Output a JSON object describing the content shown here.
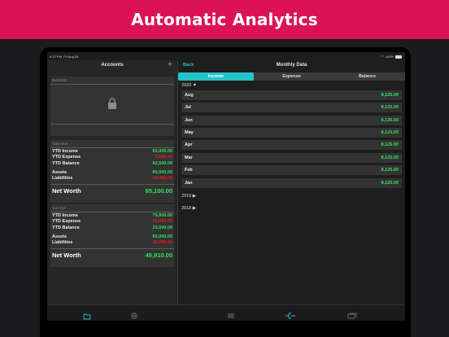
{
  "banner": {
    "title": "Automatic Analytics"
  },
  "status": {
    "time": "5:17 PM",
    "date": "Fri Aug 28",
    "battery": "100%"
  },
  "left": {
    "title": "Accounts",
    "add_label": "+",
    "locked_card": {
      "name": "Business"
    },
    "cards": [
      {
        "name": "Jane Doe",
        "rows": [
          {
            "label": "YTD Income",
            "value": "65,000.00",
            "color": "#2ee35a"
          },
          {
            "label": "YTD Expense",
            "value": "2,500.00",
            "color": "#e61a24"
          },
          {
            "label": "YTD Balance",
            "value": "62,500.00",
            "color": "#2ee35a"
          },
          {
            "label": "Assets",
            "value": "80,000.00",
            "color": "#2ee35a"
          },
          {
            "label": "Liabilities",
            "value": "14,900.00",
            "color": "#e61a24"
          }
        ],
        "net_worth_label": "Net Worth",
        "net_worth_value": "65,100.00"
      },
      {
        "name": "Jon Doe",
        "rows": [
          {
            "label": "YTD Income",
            "value": "75,000.00",
            "color": "#2ee35a"
          },
          {
            "label": "YTD Expense",
            "value": "52,000.00",
            "color": "#e61a24"
          },
          {
            "label": "YTD Balance",
            "value": "23,000.00",
            "color": "#2ee35a"
          },
          {
            "label": "Assets",
            "value": "60,000.00",
            "color": "#2ee35a"
          },
          {
            "label": "Liabilities",
            "value": "10,090.00",
            "color": "#e61a24"
          }
        ],
        "net_worth_label": "Net Worth",
        "net_worth_value": "49,910.00"
      }
    ]
  },
  "right": {
    "back_label": "Back",
    "title": "Monthly Data",
    "segments": [
      "Income",
      "Expense",
      "Balance"
    ],
    "active_segment": "Income",
    "year_current": "2020 ▼",
    "months": [
      {
        "name": "Aug",
        "value": "8,125.00"
      },
      {
        "name": "Jul",
        "value": "8,125.00"
      },
      {
        "name": "Jun",
        "value": "8,125.00"
      },
      {
        "name": "May",
        "value": "8,125.00"
      },
      {
        "name": "Apr",
        "value": "8,125.00"
      },
      {
        "name": "Mar",
        "value": "8,125.00"
      },
      {
        "name": "Feb",
        "value": "8,125.00"
      },
      {
        "name": "Jan",
        "value": "8,125.00"
      }
    ],
    "other_years": [
      "2019 ▶",
      "2018 ▶"
    ]
  },
  "tabbar": {
    "icons": [
      "folder-icon",
      "gear-icon",
      "list-icon",
      "flow-icon",
      "cards-icon"
    ],
    "accent": "#23c4c9"
  }
}
